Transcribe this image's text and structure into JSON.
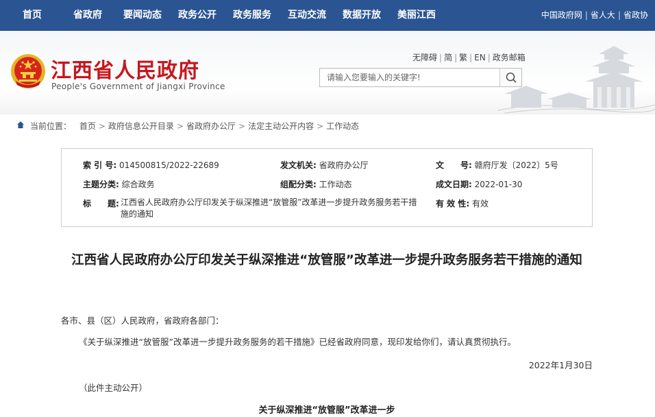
{
  "nav": {
    "items": [
      {
        "label": "首页"
      },
      {
        "label": "省政府"
      },
      {
        "label": "要闻动态"
      },
      {
        "label": "政务公开"
      },
      {
        "label": "政务服务"
      },
      {
        "label": "互动交流"
      },
      {
        "label": "数据开放"
      },
      {
        "label": "美丽江西"
      }
    ],
    "links": [
      {
        "label": "中国政府网"
      },
      {
        "label": "省人大"
      },
      {
        "label": "省政协"
      }
    ]
  },
  "header": {
    "logo_cn": "江西省人民政府",
    "logo_en": "People's Government of Jiangxi Province",
    "utility": [
      "无障碍",
      "简",
      "繁",
      "EN",
      "政务邮箱"
    ],
    "search_placeholder": "请输入您要输入的关键字!"
  },
  "breadcrumb": {
    "prefix": "当前位置：",
    "items": [
      "首页",
      "政府信息公开目录",
      "省政府办公厅",
      "法定主动公开内容",
      "工作动态"
    ]
  },
  "info": {
    "index_label": "索 引 号:",
    "index_value": "014500815/2022-22689",
    "issuer_label": "发文机关:",
    "issuer_value": "省政府办公厅",
    "docno_label": "文　　号:",
    "docno_value": "赣府厅发〔2022〕5号",
    "topic_label": "主题分类:",
    "topic_value": "综合政务",
    "category_label": "组配分类:",
    "category_value": "工作动态",
    "date_label": "成文日期:",
    "date_value": "2022-01-30",
    "title_label": "标　　题:",
    "title_value": "江西省人民政府办公厅印发关于纵深推进“放管服”改革进一步提升政务服务若干措施的通知",
    "valid_label": "有 效 性:",
    "valid_value": "有效"
  },
  "article": {
    "title": "江西省人民政府办公厅印发关于纵深推进“放管服”改革进一步提升政务服务若干措施的通知",
    "salutation": "各市、县（区）人民政府，省政府各部门：",
    "body": "《关于纵深推进“放管服”改革进一步提升政务服务的若干措施》已经省政府同意，现印发给你们，请认真贯彻执行。",
    "date": "2022年1月30日",
    "disclosure": "（此件主动公开）",
    "attachment_title": "关于纵深推进“放管服”改革进一步"
  },
  "colors": {
    "nav_bg": "#2b5492",
    "logo_red": "#c8161d"
  }
}
